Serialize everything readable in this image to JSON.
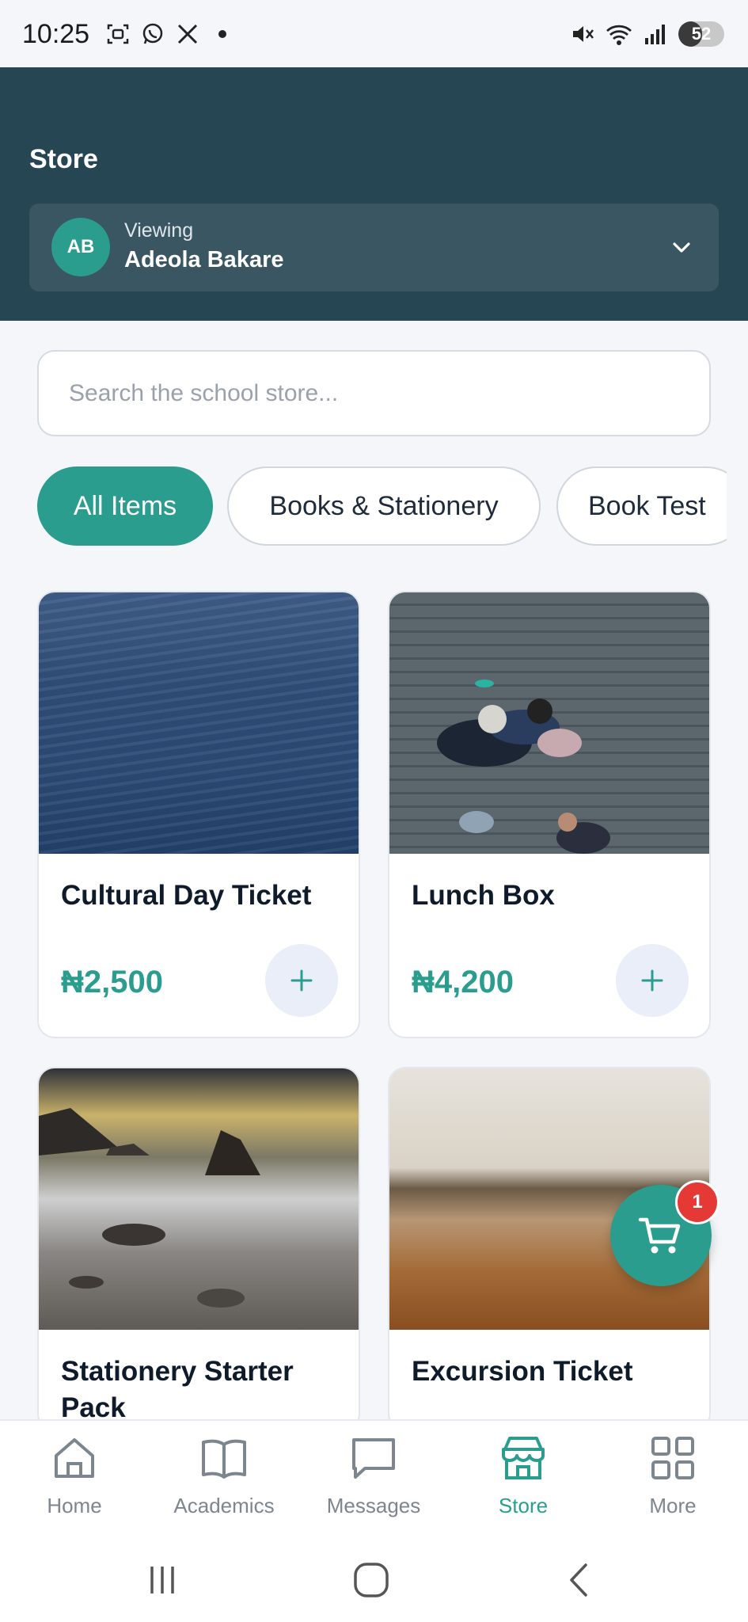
{
  "status_bar": {
    "time": "10:25",
    "battery": "52",
    "battery_level": 0.52
  },
  "header": {
    "title": "Store",
    "viewer": {
      "initials": "AB",
      "label": "Viewing",
      "name": "Adeola Bakare"
    }
  },
  "search": {
    "placeholder": "Search the school store..."
  },
  "categories": [
    {
      "label": "All Items",
      "active": true
    },
    {
      "label": "Books & Stationery",
      "active": false
    },
    {
      "label": "Book Test",
      "active": false
    }
  ],
  "products": [
    {
      "title": "Cultural Day Ticket",
      "price": "₦2,500",
      "image": "sea-waves-photo"
    },
    {
      "title": "Lunch Box",
      "price": "₦4,200",
      "image": "people-on-deck-photo"
    },
    {
      "title": "Stationery Starter Pack",
      "price": "",
      "image": "rocky-beach-photo"
    },
    {
      "title": "Excursion Ticket",
      "price": "",
      "image": "beach-sunset-photo"
    }
  ],
  "cart": {
    "count": "1"
  },
  "bottom_nav": [
    {
      "label": "Home",
      "icon": "home-icon",
      "active": false
    },
    {
      "label": "Academics",
      "icon": "book-icon",
      "active": false
    },
    {
      "label": "Messages",
      "icon": "message-icon",
      "active": false
    },
    {
      "label": "Store",
      "icon": "store-icon",
      "active": true
    },
    {
      "label": "More",
      "icon": "grid-icon",
      "active": false
    }
  ],
  "colors": {
    "header": "#264653",
    "accent": "#2a9d8f",
    "badge": "#e53935"
  }
}
